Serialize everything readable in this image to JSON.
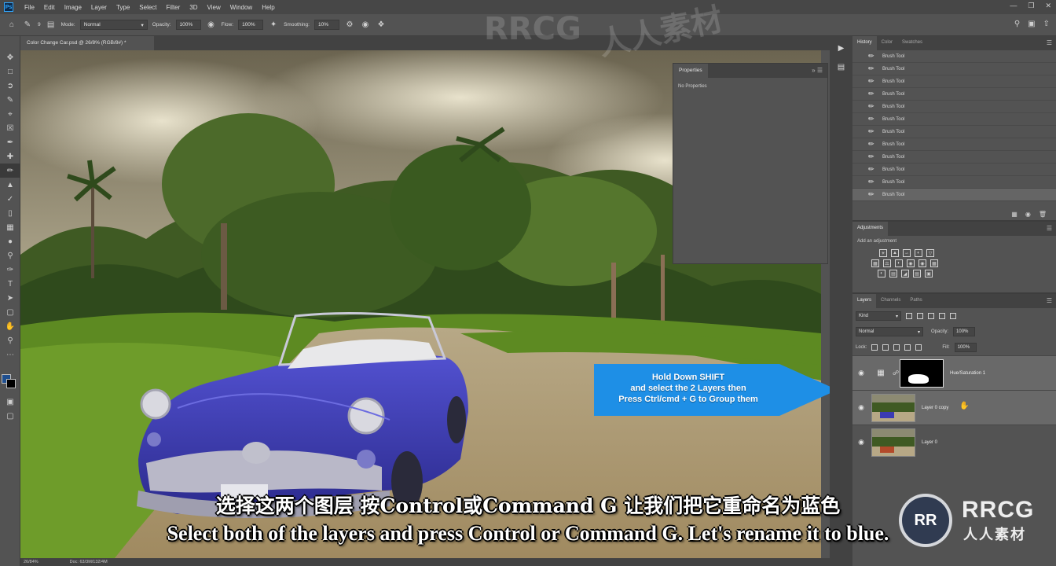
{
  "menubar": {
    "logo": "Ps",
    "items": [
      "File",
      "Edit",
      "Image",
      "Layer",
      "Type",
      "Select",
      "Filter",
      "3D",
      "View",
      "Window",
      "Help"
    ]
  },
  "options": {
    "brush_size": "9",
    "mode_label": "Mode:",
    "mode_value": "Normal",
    "opacity_label": "Opacity:",
    "opacity_value": "100%",
    "flow_label": "Flow:",
    "flow_value": "100%",
    "smoothing_label": "Smoothing:",
    "smoothing_value": "10%"
  },
  "document": {
    "tab_title": "Color Change Car.psd @ 26/8% (RGB/8#) *",
    "status_zoom": "26/84%",
    "status_doc": "Doc: 63/3M/132/4M"
  },
  "properties": {
    "title": "Properties",
    "empty_text": "No Properties"
  },
  "history": {
    "tabs": [
      "History",
      "Color",
      "Swatches"
    ],
    "items": [
      "Brush Tool",
      "Brush Tool",
      "Brush Tool",
      "Brush Tool",
      "Brush Tool",
      "Brush Tool",
      "Brush Tool",
      "Brush Tool",
      "Brush Tool",
      "Brush Tool",
      "Brush Tool",
      "Brush Tool"
    ]
  },
  "adjustments": {
    "title": "Adjustments",
    "add_text": "Add an adjustment"
  },
  "layers": {
    "tabs": [
      "Layers",
      "Channels",
      "Paths"
    ],
    "filter_value": "Kind",
    "blend_value": "Normal",
    "opacity_label": "Opacity:",
    "opacity_value": "100%",
    "lock_label": "Lock:",
    "fill_label": "Fill:",
    "fill_value": "100%",
    "items": [
      {
        "name": "Hue/Saturation 1",
        "type": "adjustment"
      },
      {
        "name": "Layer 0 copy",
        "type": "pixel"
      },
      {
        "name": "Layer 0",
        "type": "pixel"
      }
    ]
  },
  "callout": {
    "line1": "Hold Down SHIFT",
    "line2": "and select the 2 Layers then",
    "line3": "Press Ctrl/cmd + G  to Group them",
    "color": "#1e8fe6"
  },
  "subtitles": {
    "chinese": "选择这两个图层 按Control或Command G 让我们把它重命名为蓝色",
    "english": "Select both of the layers and press Control or Command G. Let's rename it to blue."
  },
  "watermark": {
    "top": "RRCG",
    "top_cn": "人人素材",
    "logo_main": "RRCG",
    "logo_sub": "人人素材",
    "logo_mark": "RR"
  },
  "colors": {
    "panel": "#535353",
    "panel_dark": "#424242",
    "accent": "#31a8ff",
    "car": "#3b3ab4"
  }
}
